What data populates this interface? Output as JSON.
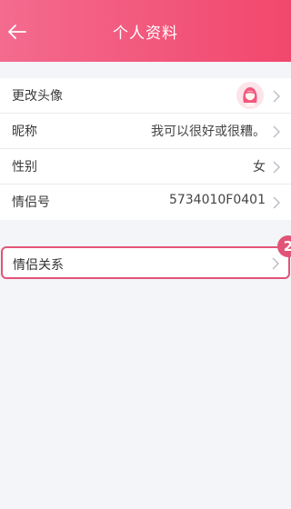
{
  "header": {
    "title": "个人资料",
    "back_icon": "back-arrow-icon",
    "gradient": [
      "#f36b8e",
      "#f2476d"
    ]
  },
  "profile": {
    "avatar_label": "更改头像",
    "nickname_label": "昵称",
    "nickname_value": "我可以很好或很糟。",
    "gender_label": "性别",
    "gender_value": "女",
    "couple_id_label": "情侣号",
    "couple_id_value": "5734010F0401"
  },
  "relation": {
    "label": "情侣关系",
    "badge": "2",
    "accent": "#e25477"
  }
}
